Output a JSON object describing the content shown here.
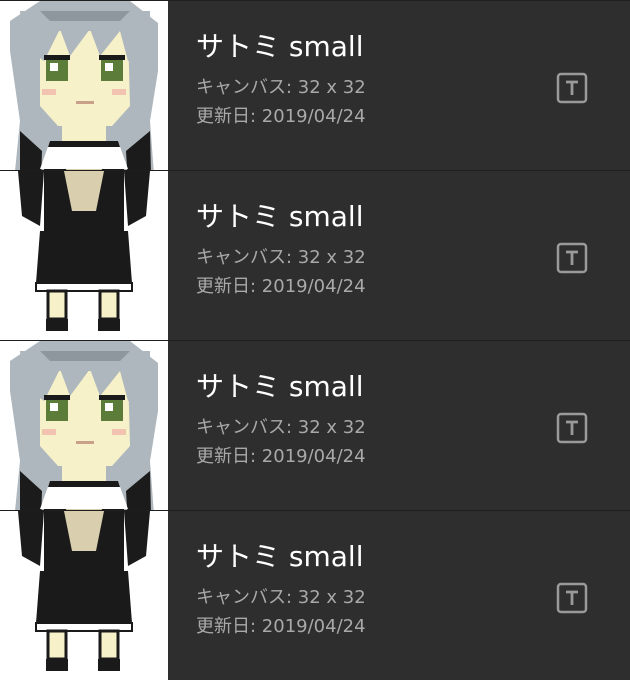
{
  "items": [
    {
      "name": "サトミ small",
      "canvas_label": "キャンバス",
      "canvas_size": "32 x 32",
      "updated_label": "更新日",
      "updated_date": "2019/04/24",
      "icon": "text-type-icon"
    },
    {
      "name": "サトミ small",
      "canvas_label": "キャンバス",
      "canvas_size": "32 x 32",
      "updated_label": "更新日",
      "updated_date": "2019/04/24",
      "icon": "text-type-icon"
    },
    {
      "name": "サトミ small",
      "canvas_label": "キャンバス",
      "canvas_size": "32 x 32",
      "updated_label": "更新日",
      "updated_date": "2019/04/24",
      "icon": "text-type-icon"
    },
    {
      "name": "サトミ small",
      "canvas_label": "キャンバス",
      "canvas_size": "32 x 32",
      "updated_label": "更新日",
      "updated_date": "2019/04/24",
      "icon": "text-type-icon"
    }
  ],
  "colors": {
    "background": "#2e2e2e",
    "title_text": "#ffffff",
    "meta_text": "#a9a9a9",
    "icon_stroke": "#9a9a9a"
  }
}
